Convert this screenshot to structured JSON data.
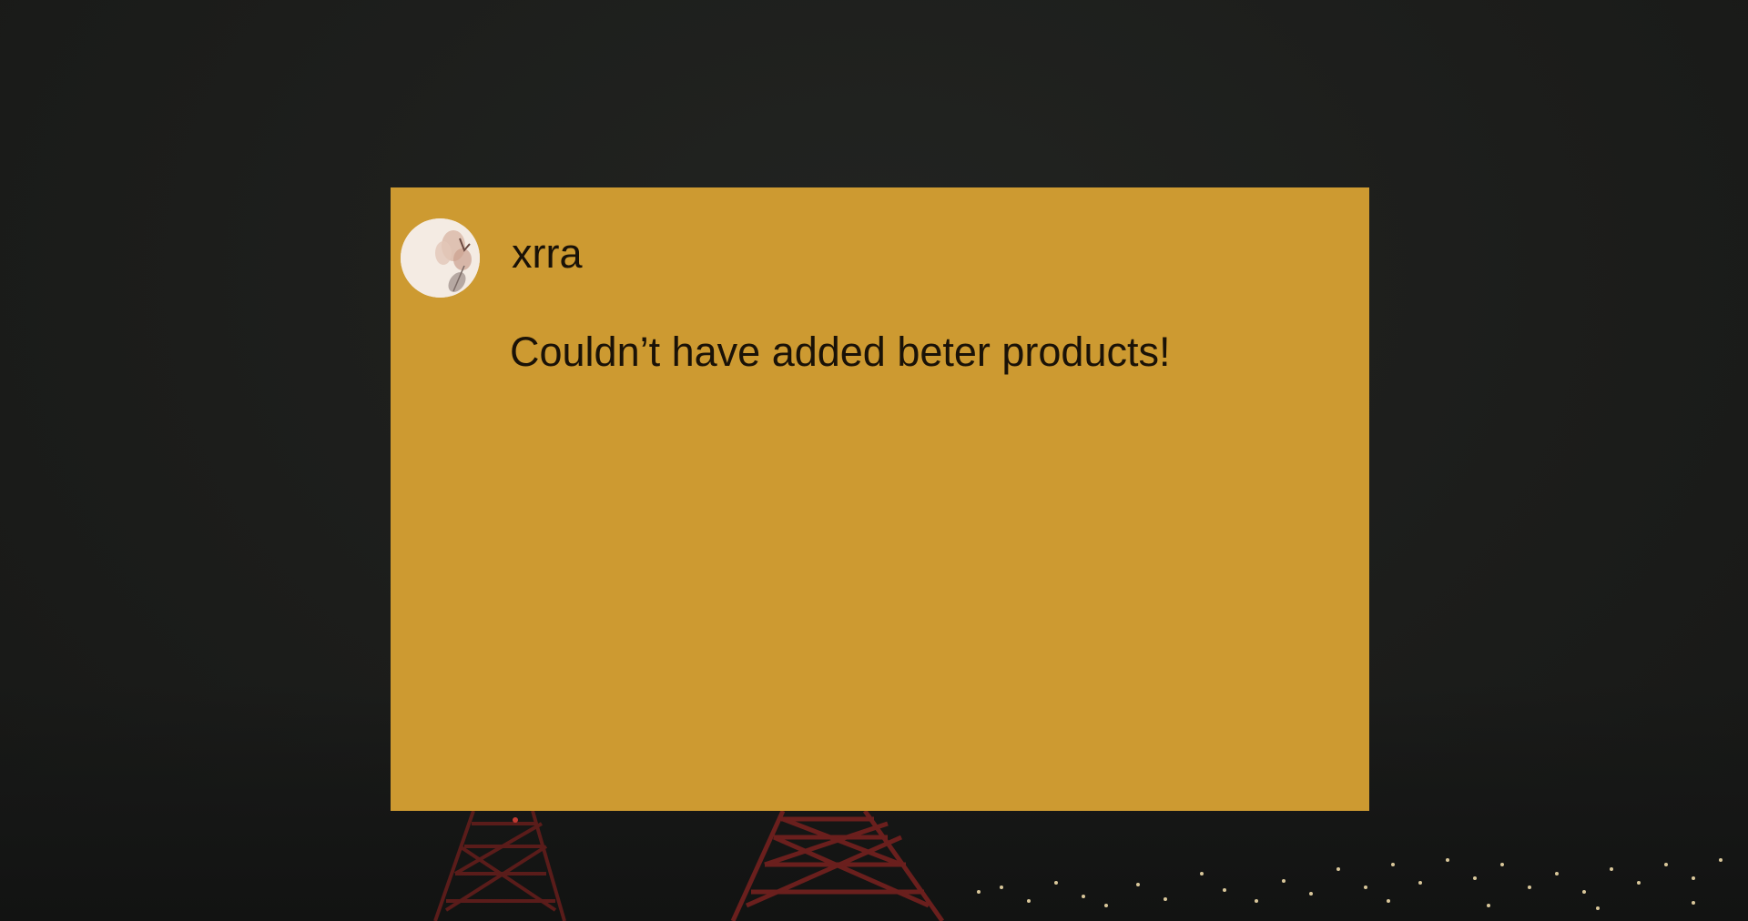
{
  "comment_card": {
    "username": "xrra",
    "text": "Couldn’t have added beter products!",
    "background_color": "#cd9a31"
  },
  "avatar": {
    "icon": "flower-avatar-icon"
  },
  "background": {
    "description_icon": "night-city-tower-icon"
  }
}
